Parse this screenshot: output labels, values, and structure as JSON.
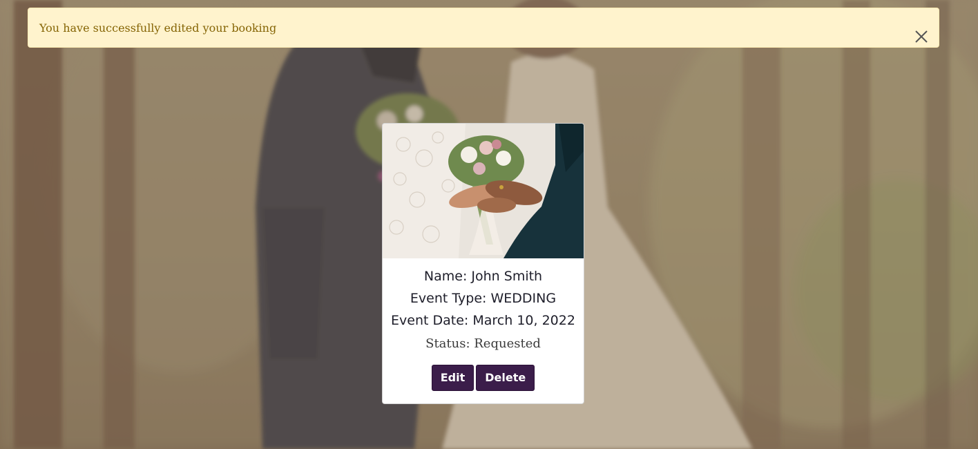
{
  "alert": {
    "message": "You have successfully edited your booking",
    "close_icon": "close-icon"
  },
  "booking_card": {
    "name_line": "Name: John Smith",
    "event_type_line": "Event Type: WEDDING",
    "event_date_line": "Event Date: March 10, 2022",
    "status_line": "Status: Requested",
    "edit_label": "Edit",
    "delete_label": "Delete"
  },
  "colors": {
    "alert_bg": "#fff3cd",
    "alert_text": "#856404",
    "button_bg": "#3b1d4a",
    "card_bg": "#ffffff"
  }
}
